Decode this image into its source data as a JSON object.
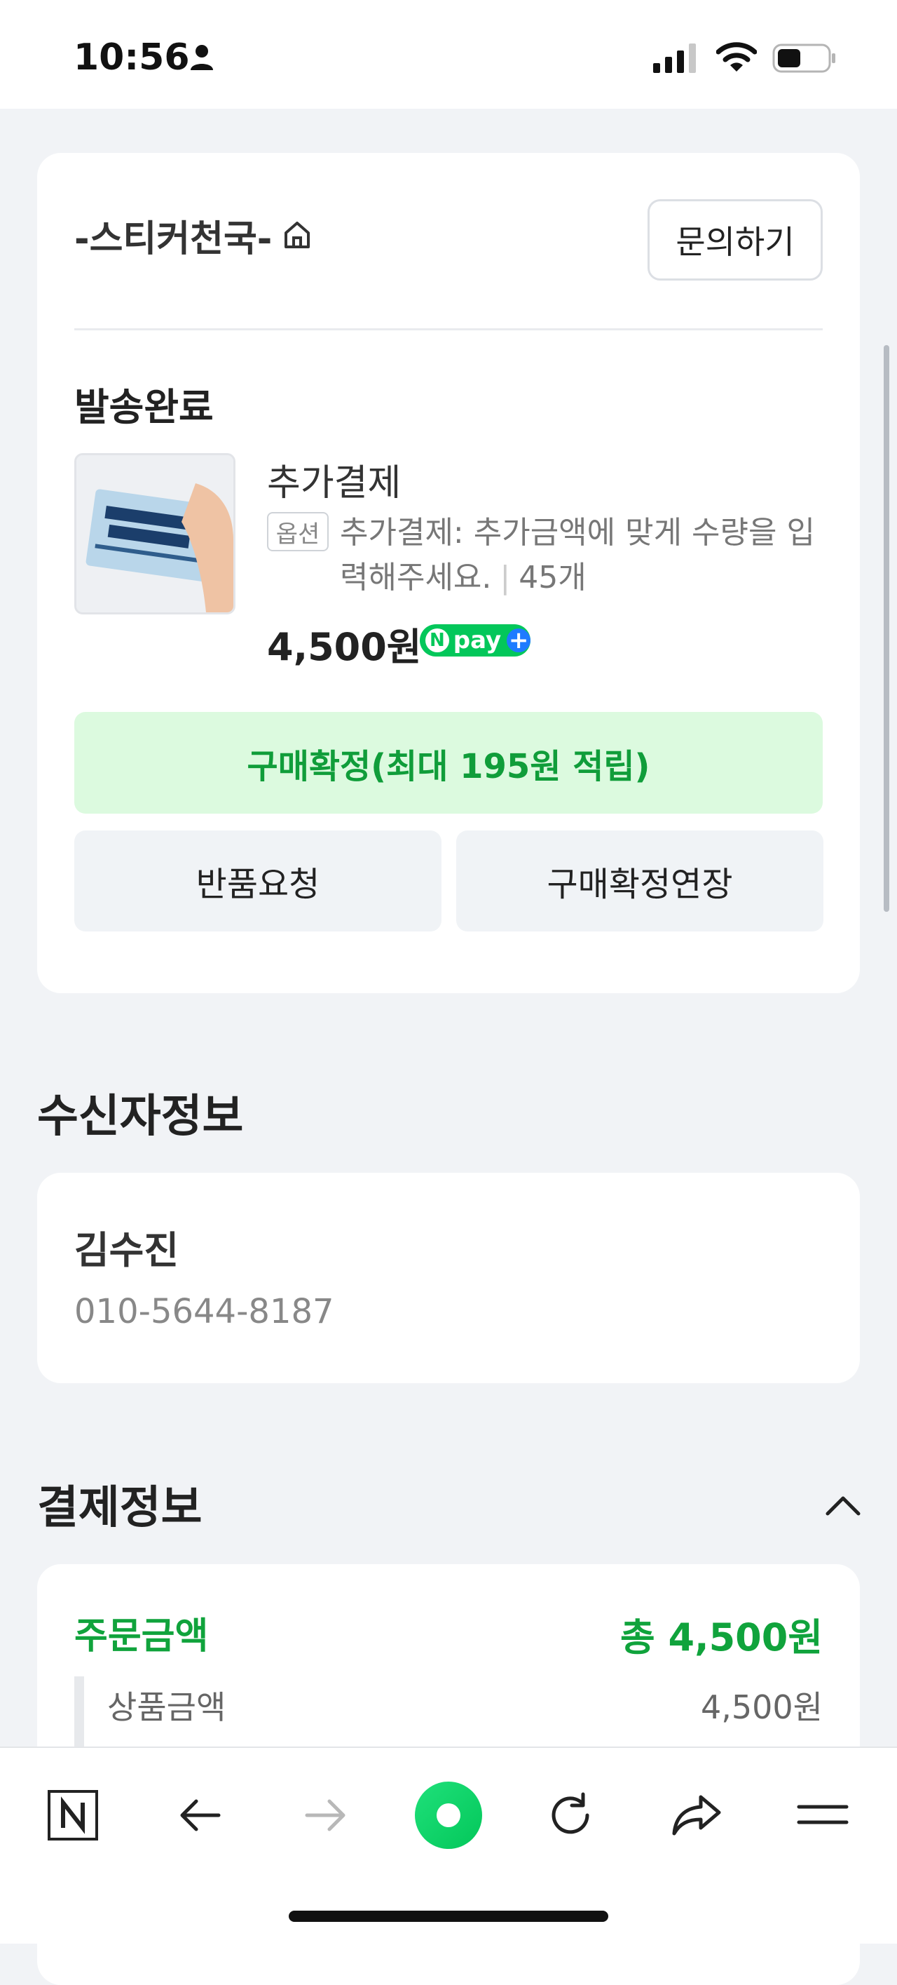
{
  "status_bar": {
    "time": "10:56"
  },
  "seller_section": {
    "seller_name": "-스티커천국-",
    "inquiry_label": "문의하기",
    "delivery_status": "발송완료",
    "product": {
      "name": "추가결제",
      "option_badge": "옵션",
      "option_text": "추가결제: 추가금액에 맞게 수량을 입력해주세요.",
      "quantity": "45개",
      "price": "4,500원",
      "npay_label": "pay"
    },
    "confirm_label": "구매확정(최대 195원 적립)",
    "return_label": "반품요청",
    "extend_label": "구매확정연장"
  },
  "receiver_section": {
    "title": "수신자정보",
    "name": "김수진",
    "phone": "010-5644-8187"
  },
  "payment_section": {
    "title": "결제정보",
    "order_label": "주문금액",
    "order_total": "총 4,500원",
    "product_amount_label": "상품금액",
    "product_amount_value": "4,500원"
  },
  "colors": {
    "accent_green": "#10a33c",
    "confirm_bg": "#dcfadf",
    "page_bg": "#f1f3f6"
  },
  "icons": [
    "person-icon",
    "signal-icon",
    "wifi-icon",
    "battery-icon",
    "home-icon",
    "chevron-up-icon",
    "naver-n-icon",
    "back-arrow-icon",
    "forward-arrow-icon",
    "green-dot-icon",
    "refresh-icon",
    "share-icon",
    "menu-icon"
  ]
}
